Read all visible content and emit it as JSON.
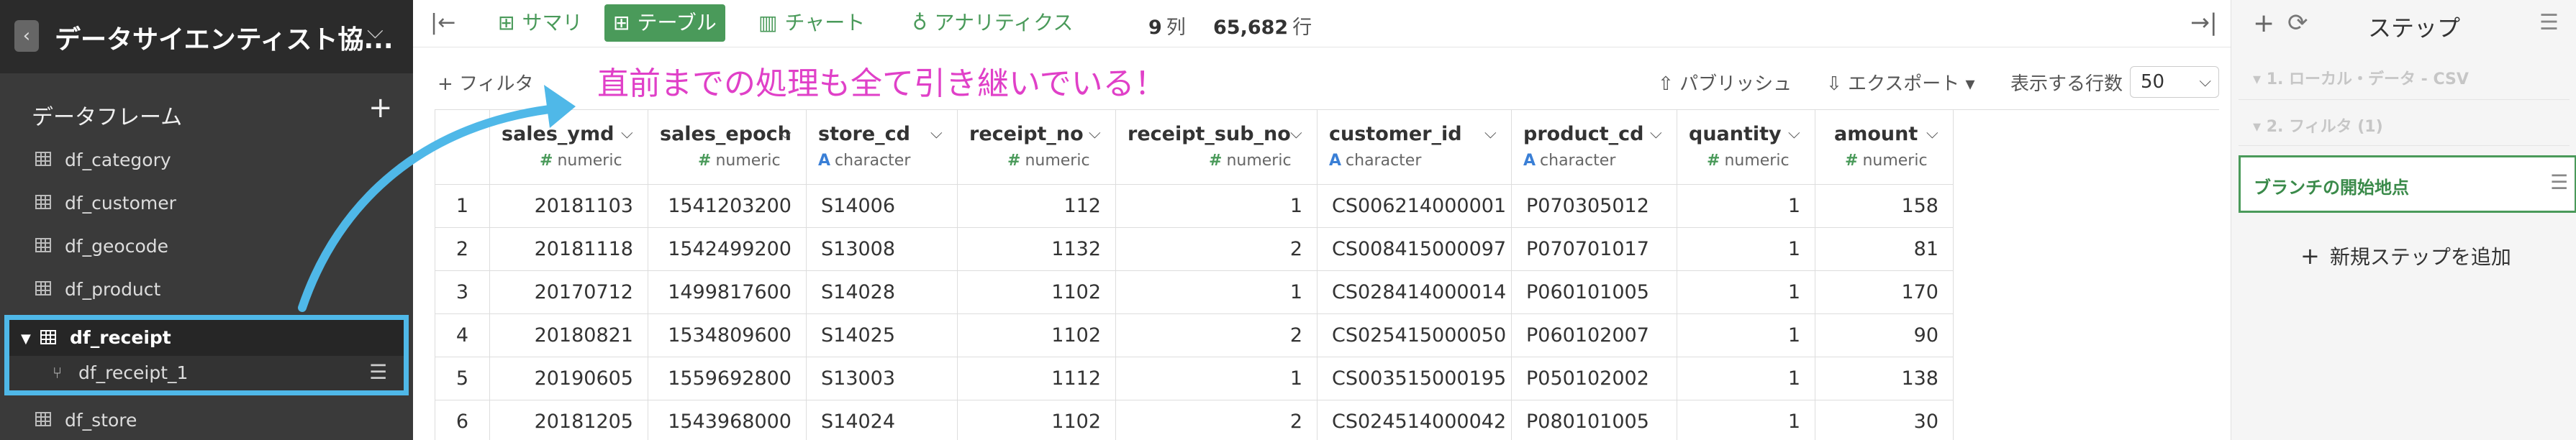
{
  "sidebar": {
    "title": "データサイエンティスト協...",
    "section_title": "データフレーム",
    "items": [
      {
        "label": "df_category"
      },
      {
        "label": "df_customer"
      },
      {
        "label": "df_geocode"
      },
      {
        "label": "df_product"
      }
    ],
    "selected": {
      "label": "df_receipt",
      "branch_label": "df_receipt_1"
    },
    "after_items": [
      {
        "label": "df_store"
      }
    ]
  },
  "toolbar": {
    "tabs": [
      {
        "label": "サマリ",
        "icon": "summary-grid-icon"
      },
      {
        "label": "テーブル",
        "icon": "table-icon",
        "active": true
      },
      {
        "label": "チャート",
        "icon": "bar-chart-icon"
      },
      {
        "label": "アナリティクス",
        "icon": "lightbulb-icon"
      }
    ],
    "columns_count": "9",
    "columns_unit": "列",
    "rows_count": "65,682",
    "rows_unit": "行"
  },
  "actionbar": {
    "filter_label": "+ フィルタ",
    "publish_label": "パブリッシュ",
    "export_label": "エクスポート",
    "rows_label": "表示する行数",
    "rows_value": "50"
  },
  "annotation": "直前までの処理も全て引き継いでいる！",
  "table": {
    "columns": [
      {
        "name": "sales_ymd",
        "type": "numeric",
        "kind": "num"
      },
      {
        "name": "sales_epoch",
        "type": "numeric",
        "kind": "num"
      },
      {
        "name": "store_cd",
        "type": "character",
        "kind": "chr"
      },
      {
        "name": "receipt_no",
        "type": "numeric",
        "kind": "num"
      },
      {
        "name": "receipt_sub_no",
        "type": "numeric",
        "kind": "num"
      },
      {
        "name": "customer_id",
        "type": "character",
        "kind": "chr"
      },
      {
        "name": "product_cd",
        "type": "character",
        "kind": "chr"
      },
      {
        "name": "quantity",
        "type": "numeric",
        "kind": "num"
      },
      {
        "name": "amount",
        "type": "numeric",
        "kind": "num"
      }
    ],
    "rows": [
      [
        "1",
        "20181103",
        "1541203200",
        "S14006",
        "112",
        "1",
        "CS006214000001",
        "P070305012",
        "1",
        "158"
      ],
      [
        "2",
        "20181118",
        "1542499200",
        "S13008",
        "1132",
        "2",
        "CS008415000097",
        "P070701017",
        "1",
        "81"
      ],
      [
        "3",
        "20170712",
        "1499817600",
        "S14028",
        "1102",
        "1",
        "CS028414000014",
        "P060101005",
        "1",
        "170"
      ],
      [
        "4",
        "20180821",
        "1534809600",
        "S14025",
        "1102",
        "2",
        "CS025415000050",
        "P060102007",
        "1",
        "90"
      ],
      [
        "5",
        "20190605",
        "1559692800",
        "S13003",
        "1112",
        "1",
        "CS003515000195",
        "P050102002",
        "1",
        "138"
      ],
      [
        "6",
        "20181205",
        "1543968000",
        "S14024",
        "1102",
        "2",
        "CS024514000042",
        "P080101005",
        "1",
        "30"
      ]
    ]
  },
  "steps_panel": {
    "title": "ステップ",
    "steps": [
      {
        "label": "▾ 1. ローカル・データ - CSV"
      },
      {
        "label": "▾ 2. フィルタ (1)"
      }
    ],
    "active_step": "ブランチの開始地点",
    "add_step_label": "新規ステップを追加"
  }
}
